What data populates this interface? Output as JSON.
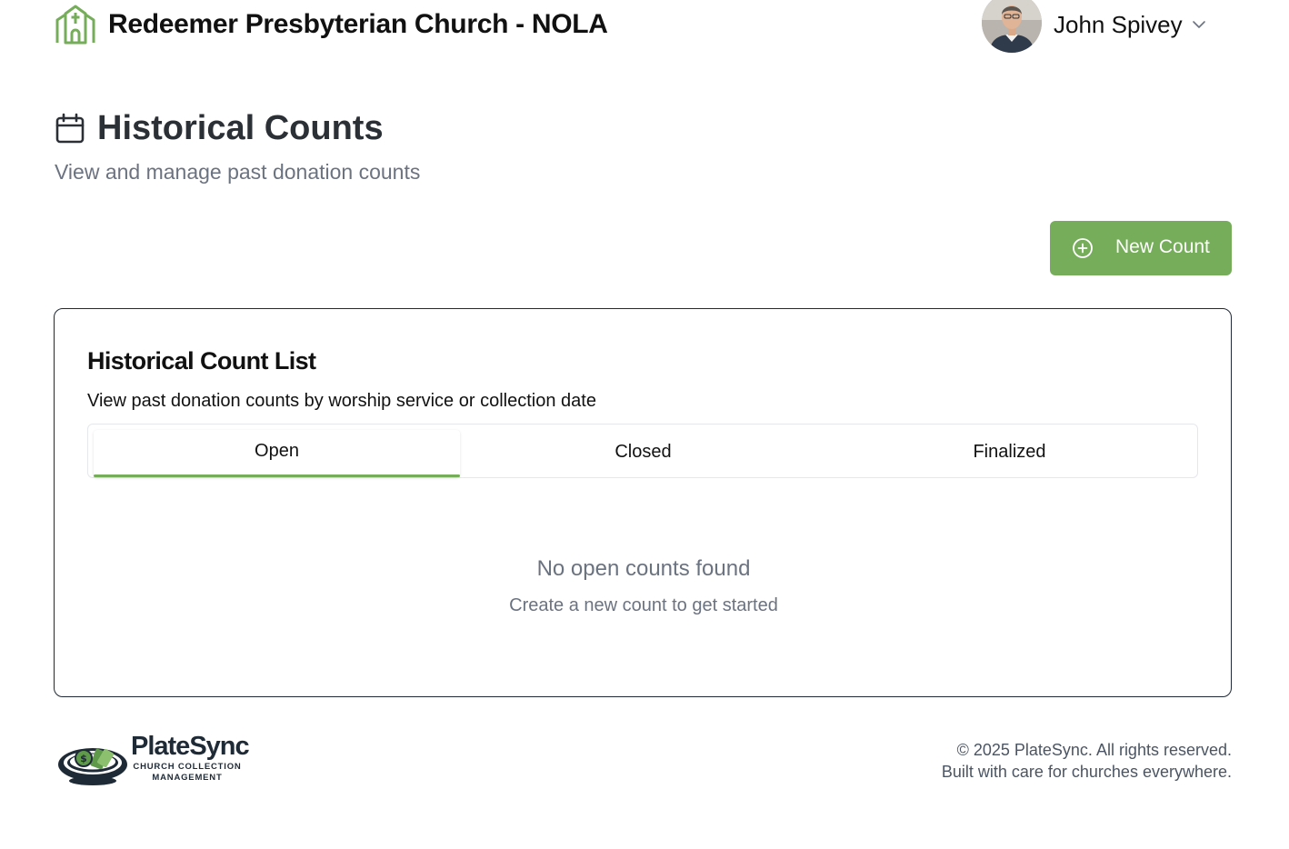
{
  "header": {
    "church_name": "Redeemer Presbyterian Church - NOLA",
    "user_name": "John Spivey"
  },
  "page": {
    "title": "Historical Counts",
    "subtitle": "View and manage past donation counts",
    "new_button_label": "New Count"
  },
  "card": {
    "title": "Historical Count List",
    "description": "View past donation counts by worship service or collection date",
    "tabs": [
      {
        "label": "Open",
        "active": true
      },
      {
        "label": "Closed",
        "active": false
      },
      {
        "label": "Finalized",
        "active": false
      }
    ],
    "empty_title": "No open counts found",
    "empty_subtitle": "Create a new count to get started"
  },
  "footer": {
    "brand_name": "PlateSync",
    "brand_tagline": "CHURCH COLLECTION MANAGEMENT",
    "copyright": "© 2025 PlateSync. All rights reserved.",
    "built_with": "Built with care for churches everywhere."
  },
  "colors": {
    "accent": "#76ad5a",
    "heading": "#2b2f36",
    "muted": "#6b7280"
  },
  "icons": {
    "church": "church-icon",
    "calendar": "calendar-icon",
    "plus": "plus-circle-icon",
    "chevron": "chevron-down-icon"
  }
}
